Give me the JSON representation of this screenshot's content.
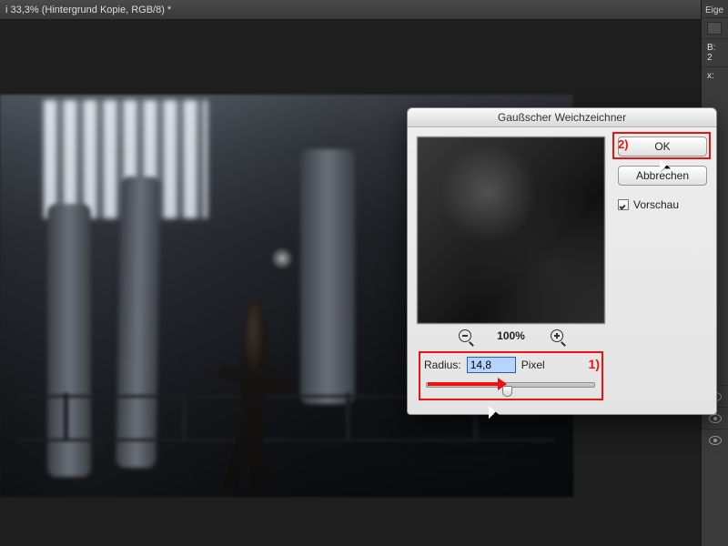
{
  "titlebar": "i 33,3% (Hintergrund Kopie, RGB/8) *",
  "right_panel": {
    "title": "Eige",
    "row_w": "B:  2",
    "row_x": "x:"
  },
  "dialog": {
    "title": "Gaußscher Weichzeichner",
    "ok": "OK",
    "cancel": "Abbrechen",
    "preview_label": "Vorschau",
    "zoom": "100%",
    "radius_label": "Radius:",
    "radius_value": "14,8",
    "radius_unit": "Pixel"
  },
  "callouts": {
    "c1": "1)",
    "c2": "2)"
  }
}
